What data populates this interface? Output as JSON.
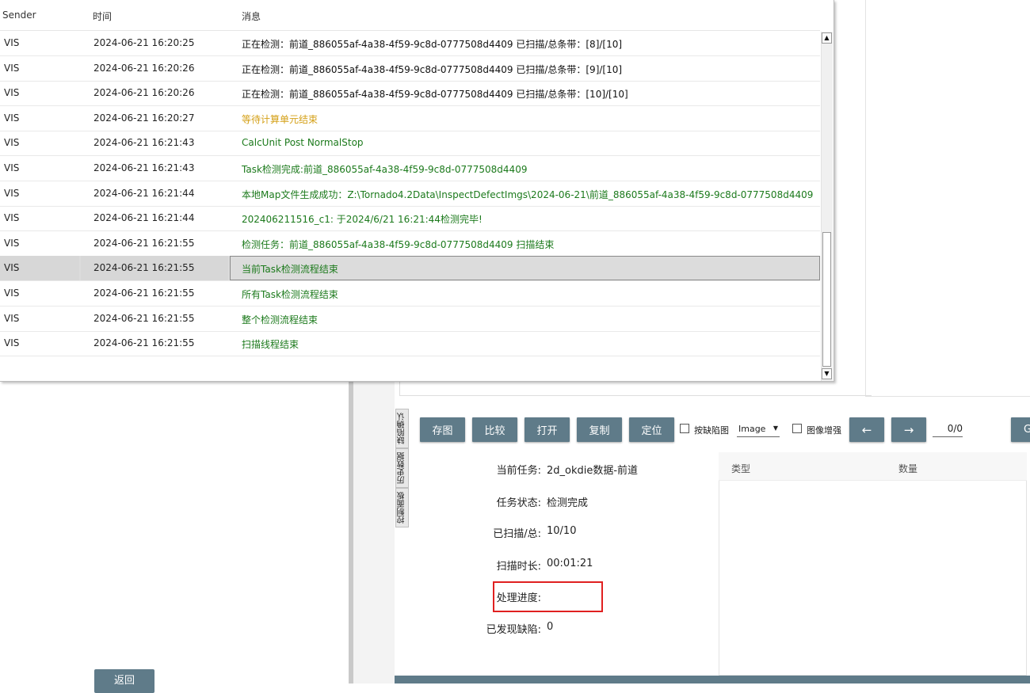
{
  "log": {
    "columns": {
      "sender": "Sender",
      "time": "时间",
      "message": "消息"
    },
    "rows": [
      {
        "sender": "VIS",
        "time": "2024-06-21 16:20:25",
        "message": "正在检测：前道_886055af-4a38-4f59-9c8d-0777508d4409  已扫描/总条带：[8]/[10]",
        "color": "#111111"
      },
      {
        "sender": "VIS",
        "time": "2024-06-21 16:20:26",
        "message": "正在检测：前道_886055af-4a38-4f59-9c8d-0777508d4409  已扫描/总条带：[9]/[10]",
        "color": "#111111"
      },
      {
        "sender": "VIS",
        "time": "2024-06-21 16:20:26",
        "message": "正在检测：前道_886055af-4a38-4f59-9c8d-0777508d4409  已扫描/总条带：[10]/[10]",
        "color": "#111111"
      },
      {
        "sender": "VIS",
        "time": "2024-06-21 16:20:27",
        "message": "等待计算单元结束",
        "color": "#d4a017"
      },
      {
        "sender": "VIS",
        "time": "2024-06-21 16:21:43",
        "message": "CalcUnit Post NormalStop",
        "color": "#1c7a1c"
      },
      {
        "sender": "VIS",
        "time": "2024-06-21 16:21:43",
        "message": "Task检测完成:前道_886055af-4a38-4f59-9c8d-0777508d4409",
        "color": "#1c7a1c"
      },
      {
        "sender": "VIS",
        "time": "2024-06-21 16:21:44",
        "message": "本地Map文件生成成功：Z:\\Tornado4.2Data\\InspectDefectImgs\\2024-06-21\\前道_886055af-4a38-4f59-9c8d-0777508d4409",
        "color": "#1c7a1c"
      },
      {
        "sender": "VIS",
        "time": "2024-06-21 16:21:44",
        "message": "202406211516_c1: 于2024/6/21 16:21:44检测完毕!",
        "color": "#1c7a1c"
      },
      {
        "sender": "VIS",
        "time": "2024-06-21 16:21:55",
        "message": "检测任务：前道_886055af-4a38-4f59-9c8d-0777508d4409 扫描结束",
        "color": "#1c7a1c"
      },
      {
        "sender": "VIS",
        "time": "2024-06-21 16:21:55",
        "message": "当前Task检测流程结束",
        "color": "#1c7a1c",
        "selected": true
      },
      {
        "sender": "VIS",
        "time": "2024-06-21 16:21:55",
        "message": "所有Task检测流程结束",
        "color": "#1c7a1c"
      },
      {
        "sender": "VIS",
        "time": "2024-06-21 16:21:55",
        "message": "整个检测流程结束",
        "color": "#1c7a1c"
      },
      {
        "sender": "VIS",
        "time": "2024-06-21 16:21:55",
        "message": "扫描线程结束",
        "color": "#1c7a1c"
      }
    ],
    "scroll_up_icon": "▲",
    "scroll_down_icon": "▼"
  },
  "side_tabs": [
    "缺陷确认",
    "历史数据",
    "控制面板"
  ],
  "toolbar": {
    "save_image": "存图",
    "compare": "比较",
    "open": "打开",
    "copy": "复制",
    "locate": "定位",
    "by_defect_label": "按缺陷图",
    "image_select": "Image",
    "enhance_label": "图像增强",
    "prev_arrow": "←",
    "next_arrow": "→",
    "page_counter": "0/0",
    "go_label": "G"
  },
  "info": {
    "current_task_label": "当前任务:",
    "current_task_value": "2d_okdie数据-前道",
    "task_status_label": "任务状态:",
    "task_status_value": "检测完成",
    "scanned_label": "已扫描/总:",
    "scanned_value": "10/10",
    "scan_time_label": "扫描时长:",
    "scan_time_value": "00:01:21",
    "progress_label": "处理进度:",
    "progress_value": "",
    "defects_label": "已发现缺陷:",
    "defects_value": "0"
  },
  "defect_table": {
    "col_type": "类型",
    "col_count": "数量"
  },
  "back_button": "返回",
  "colors": {
    "button": "#5f7b89",
    "highlight": "#e02020",
    "green_text": "#1c7a1c",
    "orange_text": "#d4a017"
  }
}
